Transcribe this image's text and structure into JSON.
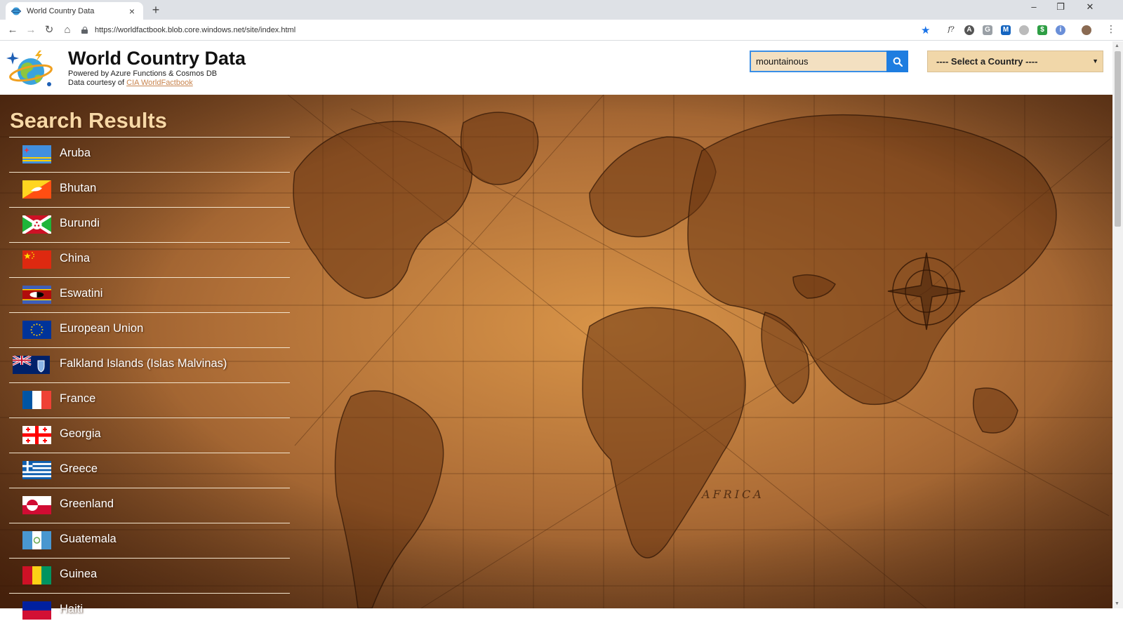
{
  "browser": {
    "tab_title": "World Country Data",
    "new_tab": "+",
    "tab_close": "×",
    "url": "https://worldfactbook.blob.core.windows.net/site/index.html",
    "window_controls": [
      "–",
      "❐",
      "✕"
    ]
  },
  "header": {
    "title": "World Country Data",
    "subtitle": "Powered by Azure Functions & Cosmos DB",
    "courtesy_prefix": "Data courtesy of ",
    "courtesy_link": "CIA WorldFactbook",
    "search_value": "mountainous",
    "select_label": "---- Select a Country ----"
  },
  "results": {
    "title": "Search Results",
    "items": [
      {
        "name": "Aruba",
        "flag": "aruba"
      },
      {
        "name": "Bhutan",
        "flag": "bhutan"
      },
      {
        "name": "Burundi",
        "flag": "burundi"
      },
      {
        "name": "China",
        "flag": "china"
      },
      {
        "name": "Eswatini",
        "flag": "eswatini"
      },
      {
        "name": "European Union",
        "flag": "eu"
      },
      {
        "name": "Falkland Islands (Islas Malvinas)",
        "flag": "falklands"
      },
      {
        "name": "France",
        "flag": "france"
      },
      {
        "name": "Georgia",
        "flag": "georgia"
      },
      {
        "name": "Greece",
        "flag": "greece"
      },
      {
        "name": "Greenland",
        "flag": "greenland"
      },
      {
        "name": "Guatemala",
        "flag": "guatemala"
      },
      {
        "name": "Guinea",
        "flag": "guinea"
      },
      {
        "name": "Haiti",
        "flag": "haiti"
      }
    ]
  },
  "colors": {
    "accent": "#1e7de0",
    "title_text": "#f7d8a6",
    "search_bg": "#f3e0c1",
    "select_bg": "#f1d7a9",
    "link": "#c8844e"
  }
}
